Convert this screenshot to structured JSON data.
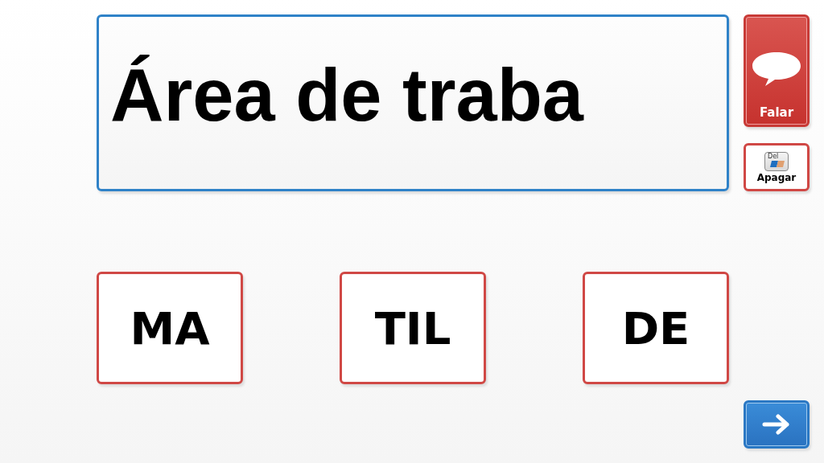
{
  "text_area": {
    "value": "Área de traba"
  },
  "word_buttons": [
    {
      "label": "MA"
    },
    {
      "label": "TIL"
    },
    {
      "label": "DE"
    }
  ],
  "side_buttons": [
    {
      "kind": "speak",
      "label": "Falar"
    },
    {
      "kind": "erase",
      "label": "Apagar",
      "icon_text": "Del"
    },
    {
      "kind": "next"
    }
  ]
}
